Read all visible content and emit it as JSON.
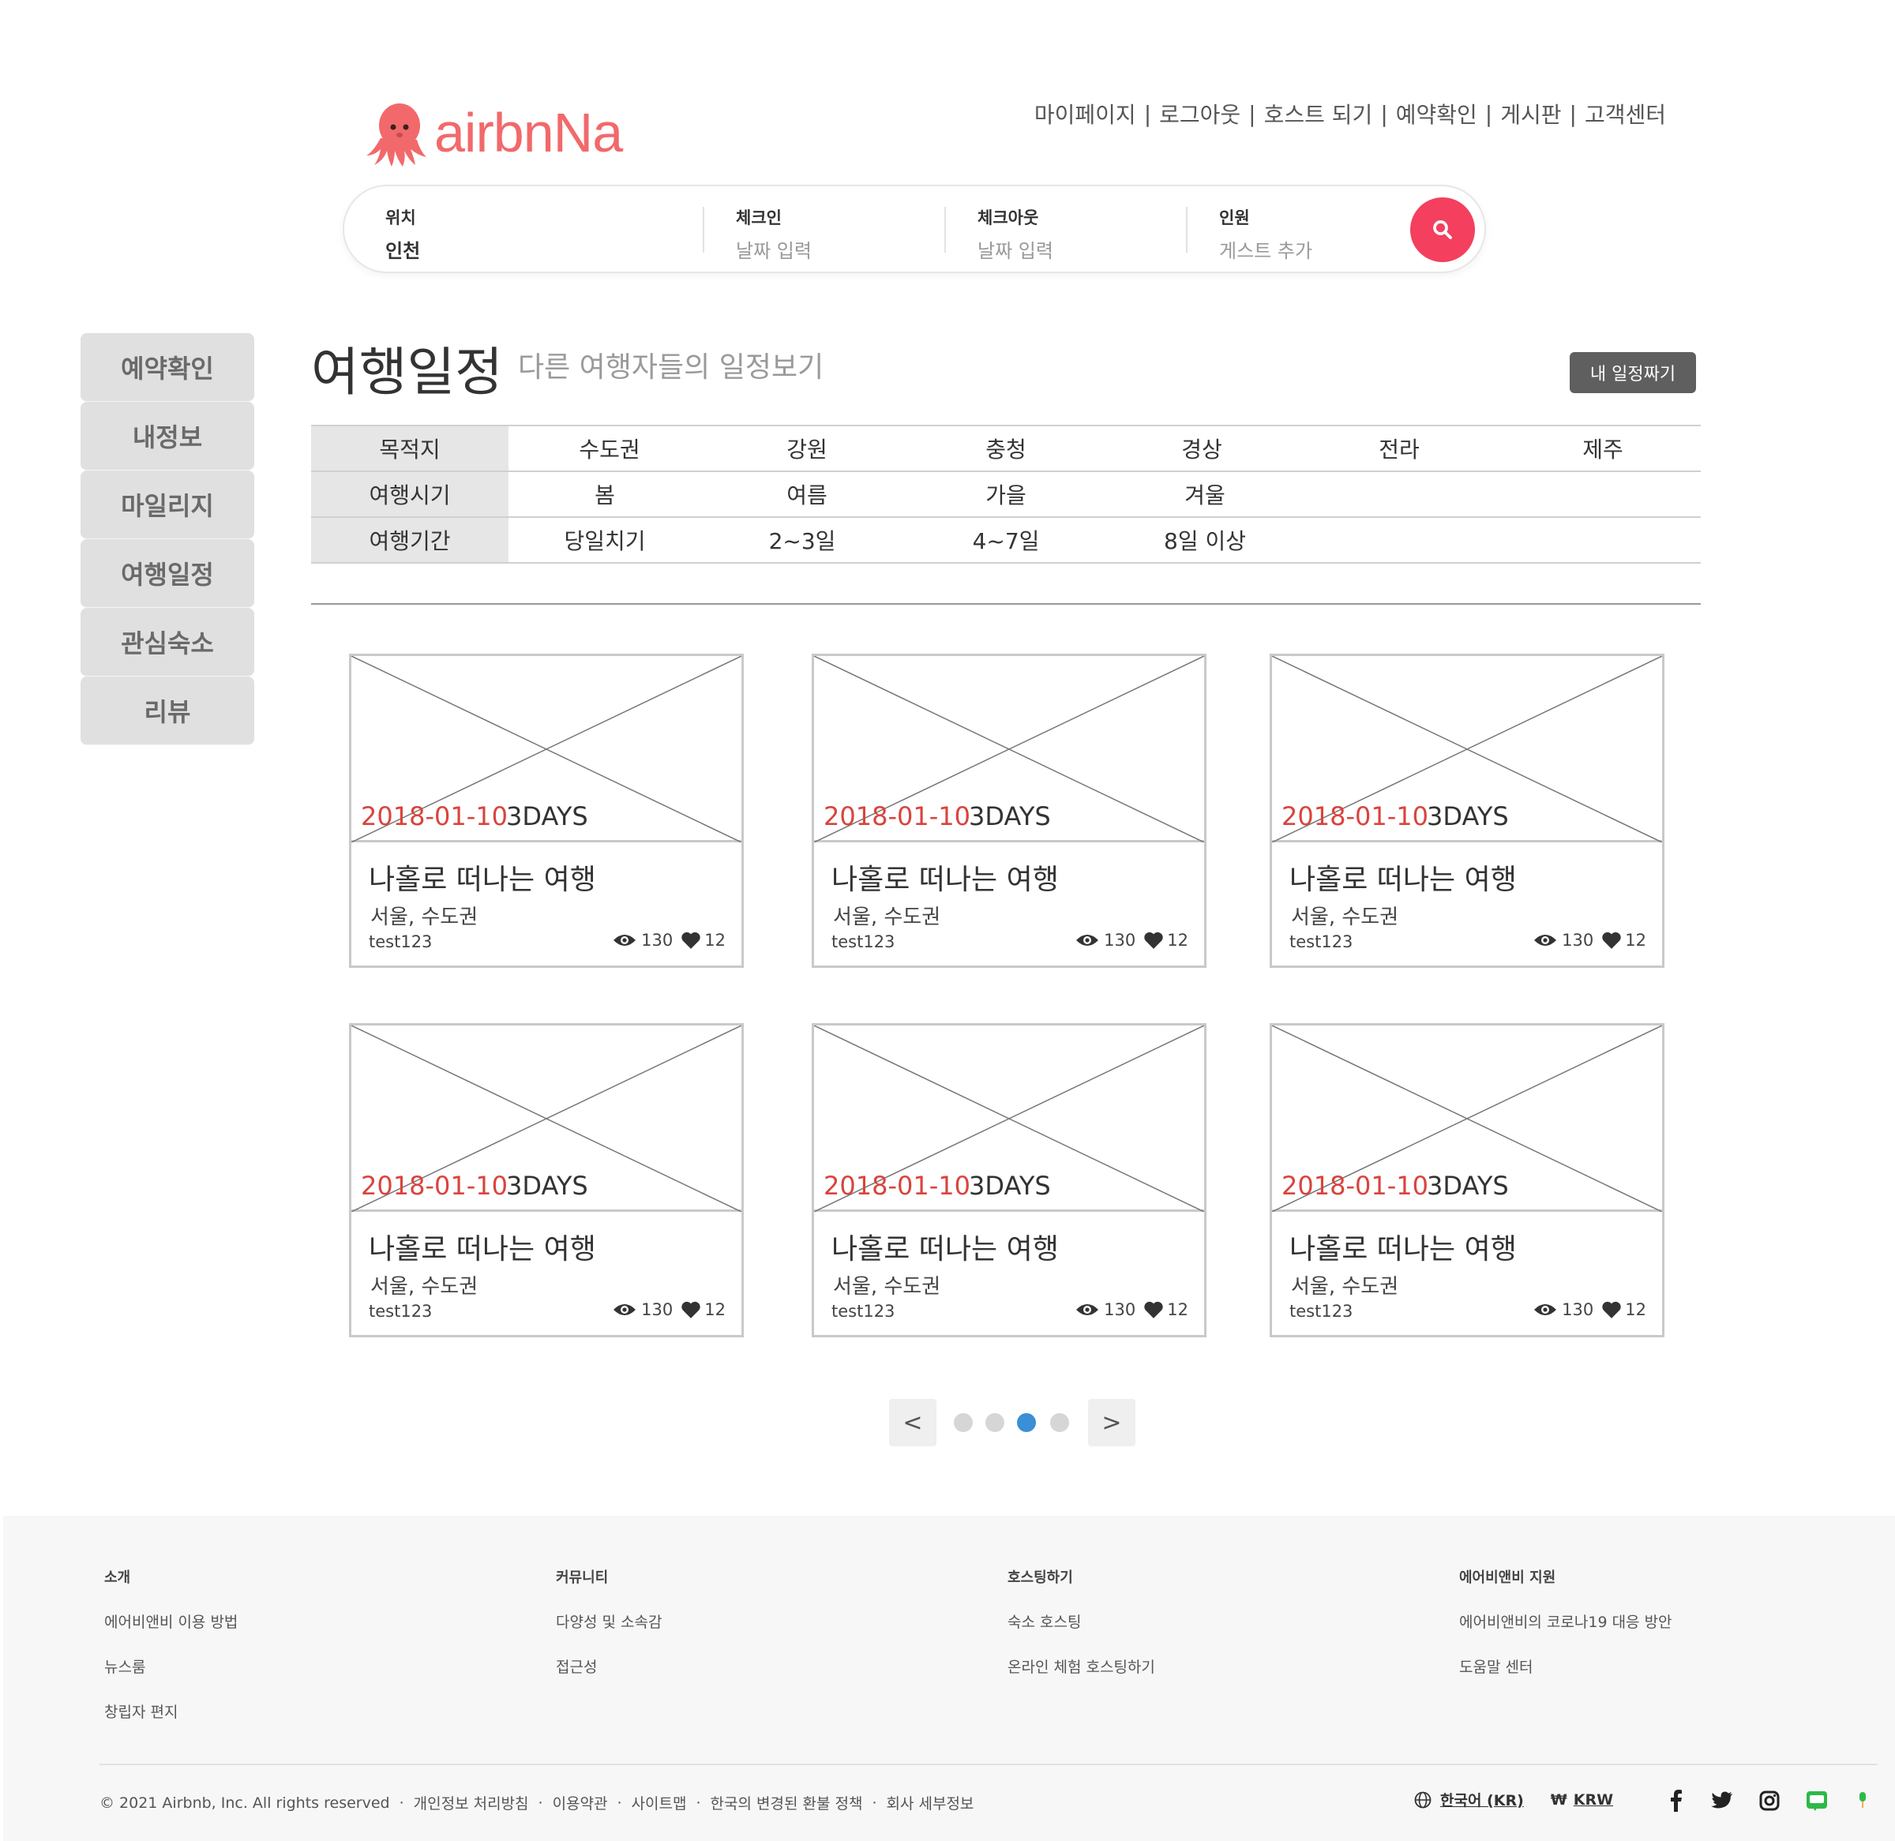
{
  "header": {
    "logo_text": "airbnNa",
    "nav": [
      "마이페이지",
      "로그아웃",
      "호스트 되기",
      "예약확인",
      "게시판",
      "고객센터"
    ],
    "nav_separator": "|"
  },
  "search": {
    "location": {
      "label": "위치",
      "value": "인천"
    },
    "checkin": {
      "label": "체크인",
      "placeholder": "날짜 입력"
    },
    "checkout": {
      "label": "체크아웃",
      "placeholder": "날짜 입력"
    },
    "guests": {
      "label": "인원",
      "placeholder": "게스트 추가"
    },
    "button_color": "#f43f5e",
    "button_icon": "search-icon"
  },
  "sidebar": {
    "items": [
      "예약확인",
      "내정보",
      "마일리지",
      "여행일정",
      "관심숙소",
      "리뷰"
    ]
  },
  "main": {
    "title": "여행일정",
    "subtitle": "다른 여행자들의 일정보기",
    "my_schedule_button": "내 일정짜기"
  },
  "filters": {
    "destination": {
      "label": "목적지",
      "options": [
        "수도권",
        "강원",
        "충청",
        "경상",
        "전라",
        "제주"
      ]
    },
    "season": {
      "label": "여행시기",
      "options": [
        "봄",
        "여름",
        "가을",
        "겨울"
      ]
    },
    "duration": {
      "label": "여행기간",
      "options": [
        "당일치기",
        "2~3일",
        "4~7일",
        "8일 이상"
      ]
    }
  },
  "cards": [
    {
      "date": "2018-01-10",
      "days": "3DAYS",
      "title": "나홀로 떠나는 여행",
      "location": "서울, 수도권",
      "user": "test123",
      "views": "130",
      "likes": "12"
    },
    {
      "date": "2018-01-10",
      "days": "3DAYS",
      "title": "나홀로 떠나는 여행",
      "location": "서울, 수도권",
      "user": "test123",
      "views": "130",
      "likes": "12"
    },
    {
      "date": "2018-01-10",
      "days": "3DAYS",
      "title": "나홀로 떠나는 여행",
      "location": "서울, 수도권",
      "user": "test123",
      "views": "130",
      "likes": "12"
    },
    {
      "date": "2018-01-10",
      "days": "3DAYS",
      "title": "나홀로 떠나는 여행",
      "location": "서울, 수도권",
      "user": "test123",
      "views": "130",
      "likes": "12"
    },
    {
      "date": "2018-01-10",
      "days": "3DAYS",
      "title": "나홀로 떠나는 여행",
      "location": "서울, 수도권",
      "user": "test123",
      "views": "130",
      "likes": "12"
    },
    {
      "date": "2018-01-10",
      "days": "3DAYS",
      "title": "나홀로 떠나는 여행",
      "location": "서울, 수도권",
      "user": "test123",
      "views": "130",
      "likes": "12"
    }
  ],
  "pagination": {
    "prev": "<",
    "next": ">",
    "pages": 4,
    "active_page": 3,
    "active_color": "#3a8fd6"
  },
  "footer": {
    "columns": [
      {
        "heading": "소개",
        "links": [
          "에어비앤비 이용 방법",
          "뉴스룸",
          "창립자 편지"
        ]
      },
      {
        "heading": "커뮤니티",
        "links": [
          "다양성 및 소속감",
          "접근성"
        ]
      },
      {
        "heading": "호스팅하기",
        "links": [
          "숙소 호스팅",
          "온라인 체험 호스팅하기"
        ]
      },
      {
        "heading": "에어비앤비 지원",
        "links": [
          "에어비앤비의 코로나19 대응 방안",
          "도움말 센터"
        ]
      }
    ],
    "copyright": "© 2021 Airbnb, Inc. All rights reserved",
    "legal_links": [
      "개인정보 처리방침",
      "이용약관",
      "사이트맵",
      "한국의 변경된 환불 정책",
      "회사 세부정보"
    ],
    "separator": "·",
    "language": "한국어 (KR)",
    "currency_symbol": "₩",
    "currency": "KRW",
    "social_icons": [
      "facebook-icon",
      "twitter-icon",
      "instagram-icon",
      "line-icon",
      "kakao-icon"
    ]
  },
  "colors": {
    "brand": "#f2696b",
    "date_red": "#d9443d"
  }
}
